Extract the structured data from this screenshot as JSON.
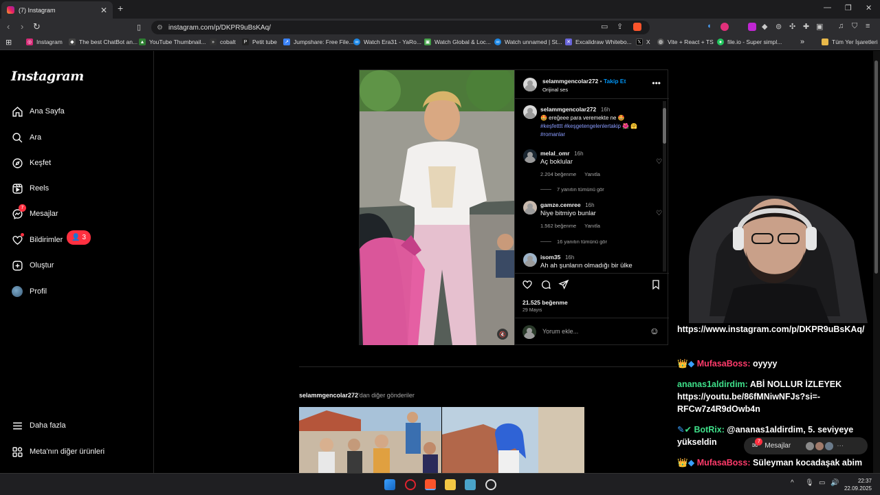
{
  "browser": {
    "tab_title": "(7) Instagram",
    "url": "instagram.com/p/DKPR9uBsKAq/",
    "bookmarks": [
      "Instagram",
      "The best ChatBot an...",
      "YouTube Thumbnail...",
      "cobalt",
      "Petit tube",
      "Jumpshare: Free File...",
      "Watch Era31 - YaRo...",
      "Watch Global & Loc...",
      "Watch unnamed | St...",
      "Excalidraw Whitebo...",
      "X",
      "Vite + React + TS",
      "file.io - Super simpl..."
    ],
    "all_bookmarks": "Tüm Yer İşaretleri"
  },
  "sidebar": {
    "logo": "Instagram",
    "items": [
      {
        "label": "Ana Sayfa",
        "icon": "home-icon"
      },
      {
        "label": "Ara",
        "icon": "search-icon"
      },
      {
        "label": "Keşfet",
        "icon": "compass-icon"
      },
      {
        "label": "Reels",
        "icon": "reels-icon"
      },
      {
        "label": "Mesajlar",
        "icon": "messenger-icon",
        "badge": "7"
      },
      {
        "label": "Bildirimler",
        "icon": "heart-icon"
      },
      {
        "label": "Oluştur",
        "icon": "plus-square-icon"
      },
      {
        "label": "Profil",
        "icon": "avatar"
      }
    ],
    "notification_pill": "3",
    "more": "Daha fazla",
    "meta": "Meta'nın diğer ürünleri"
  },
  "post": {
    "username": "selammgencolar272",
    "follow": "Takip Et",
    "audio": "Orijinal ses",
    "caption": {
      "user": "selammgencolar272",
      "time": "16h",
      "text": "🤩 ereğeee para veremekte ne 🤩",
      "tags": "#keşfetttt #keşgetengelenlertakip 🌺 🤗 #romanlar"
    },
    "comments": [
      {
        "user": "melal_omr",
        "time": "16h",
        "text": "Aç boklular",
        "likes": "2.204 beğenme",
        "reply": "Yanıtla",
        "replies": "7 yanıtın tümünü gör"
      },
      {
        "user": "gamze.cemree",
        "time": "16h",
        "text": "Niye bitmiyo bunlar",
        "likes": "1.562 beğenme",
        "reply": "Yanıtla",
        "replies": "16 yanıtın tümünü gör"
      },
      {
        "user": "isom35",
        "time": "16h",
        "text": "Ah ah şunların olmadığı bir ülke"
      }
    ],
    "like_count": "21.525 beğenme",
    "date": "29 Mayıs",
    "comment_placeholder": "Yorum ekle..."
  },
  "more_posts": {
    "user": "selammgencolar272",
    "suffix": "'dan diğer gönderiler"
  },
  "stream_chat": [
    {
      "user": "",
      "text": "https://www.instagram.com/p/DKPR9uBsKAq/"
    },
    {
      "user": "MufasaBoss:",
      "text": "oyyyy"
    },
    {
      "user": "ananas1aldirdim:",
      "text": "ABİ NOLLUR İZLEYEK https://youtu.be/86fMNiwNFJs?si=-RFCw7z4R9dOwb4n"
    },
    {
      "user": "BotRix:",
      "text": "@ananas1aldirdim, 5. seviyeye yükseldin"
    },
    {
      "user": "MufasaBoss:",
      "text": "Süleyman kocadaşak abim"
    }
  ],
  "messages_bar": {
    "label": "Mesajlar",
    "badge": "7"
  },
  "taskbar": {
    "time": "22:37",
    "date": "22.09.2025"
  }
}
